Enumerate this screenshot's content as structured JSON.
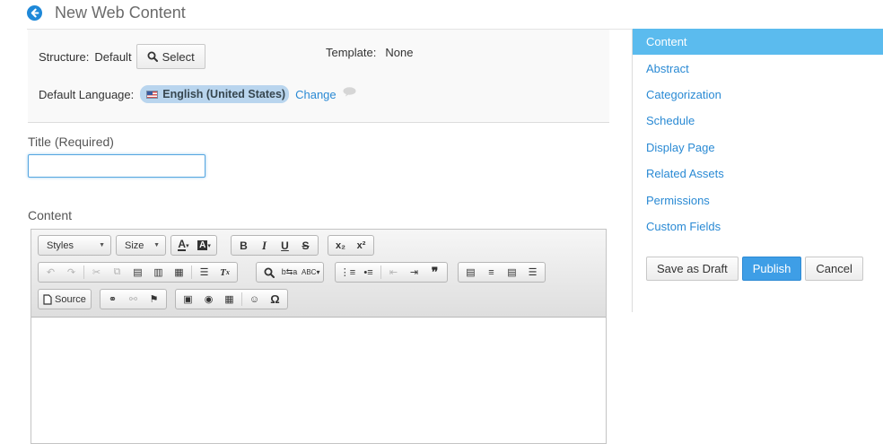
{
  "header": {
    "title": "New Web Content"
  },
  "meta": {
    "structure_label": "Structure:",
    "structure_value": "Default",
    "select_label": "Select",
    "template_label": "Template:",
    "template_value": "None",
    "language_label": "Default Language:",
    "language_value": "English (United States)",
    "change_label": "Change"
  },
  "form": {
    "title_label": "Title (Required)",
    "title_value": "",
    "content_label": "Content"
  },
  "editor": {
    "styles_combo": "Styles",
    "size_combo": "Size",
    "source_label": "Source",
    "bold": "B",
    "italic": "I",
    "underline": "U",
    "strike": "S",
    "subscript": "x₂",
    "superscript": "x²",
    "omega": "Ω",
    "quote": "❞"
  },
  "sidebar": {
    "items": [
      {
        "label": "Content",
        "active": true
      },
      {
        "label": "Abstract"
      },
      {
        "label": "Categorization"
      },
      {
        "label": "Schedule"
      },
      {
        "label": "Display Page"
      },
      {
        "label": "Related Assets"
      },
      {
        "label": "Permissions"
      },
      {
        "label": "Custom Fields"
      }
    ],
    "save_draft": "Save as Draft",
    "publish": "Publish",
    "cancel": "Cancel"
  },
  "colors": {
    "accent": "#2a8ad4",
    "active_nav": "#5bbbee",
    "publish": "#3e9ee6"
  },
  "icons": [
    "back-arrow-icon",
    "search-icon",
    "flag-icon",
    "help-icon"
  ]
}
